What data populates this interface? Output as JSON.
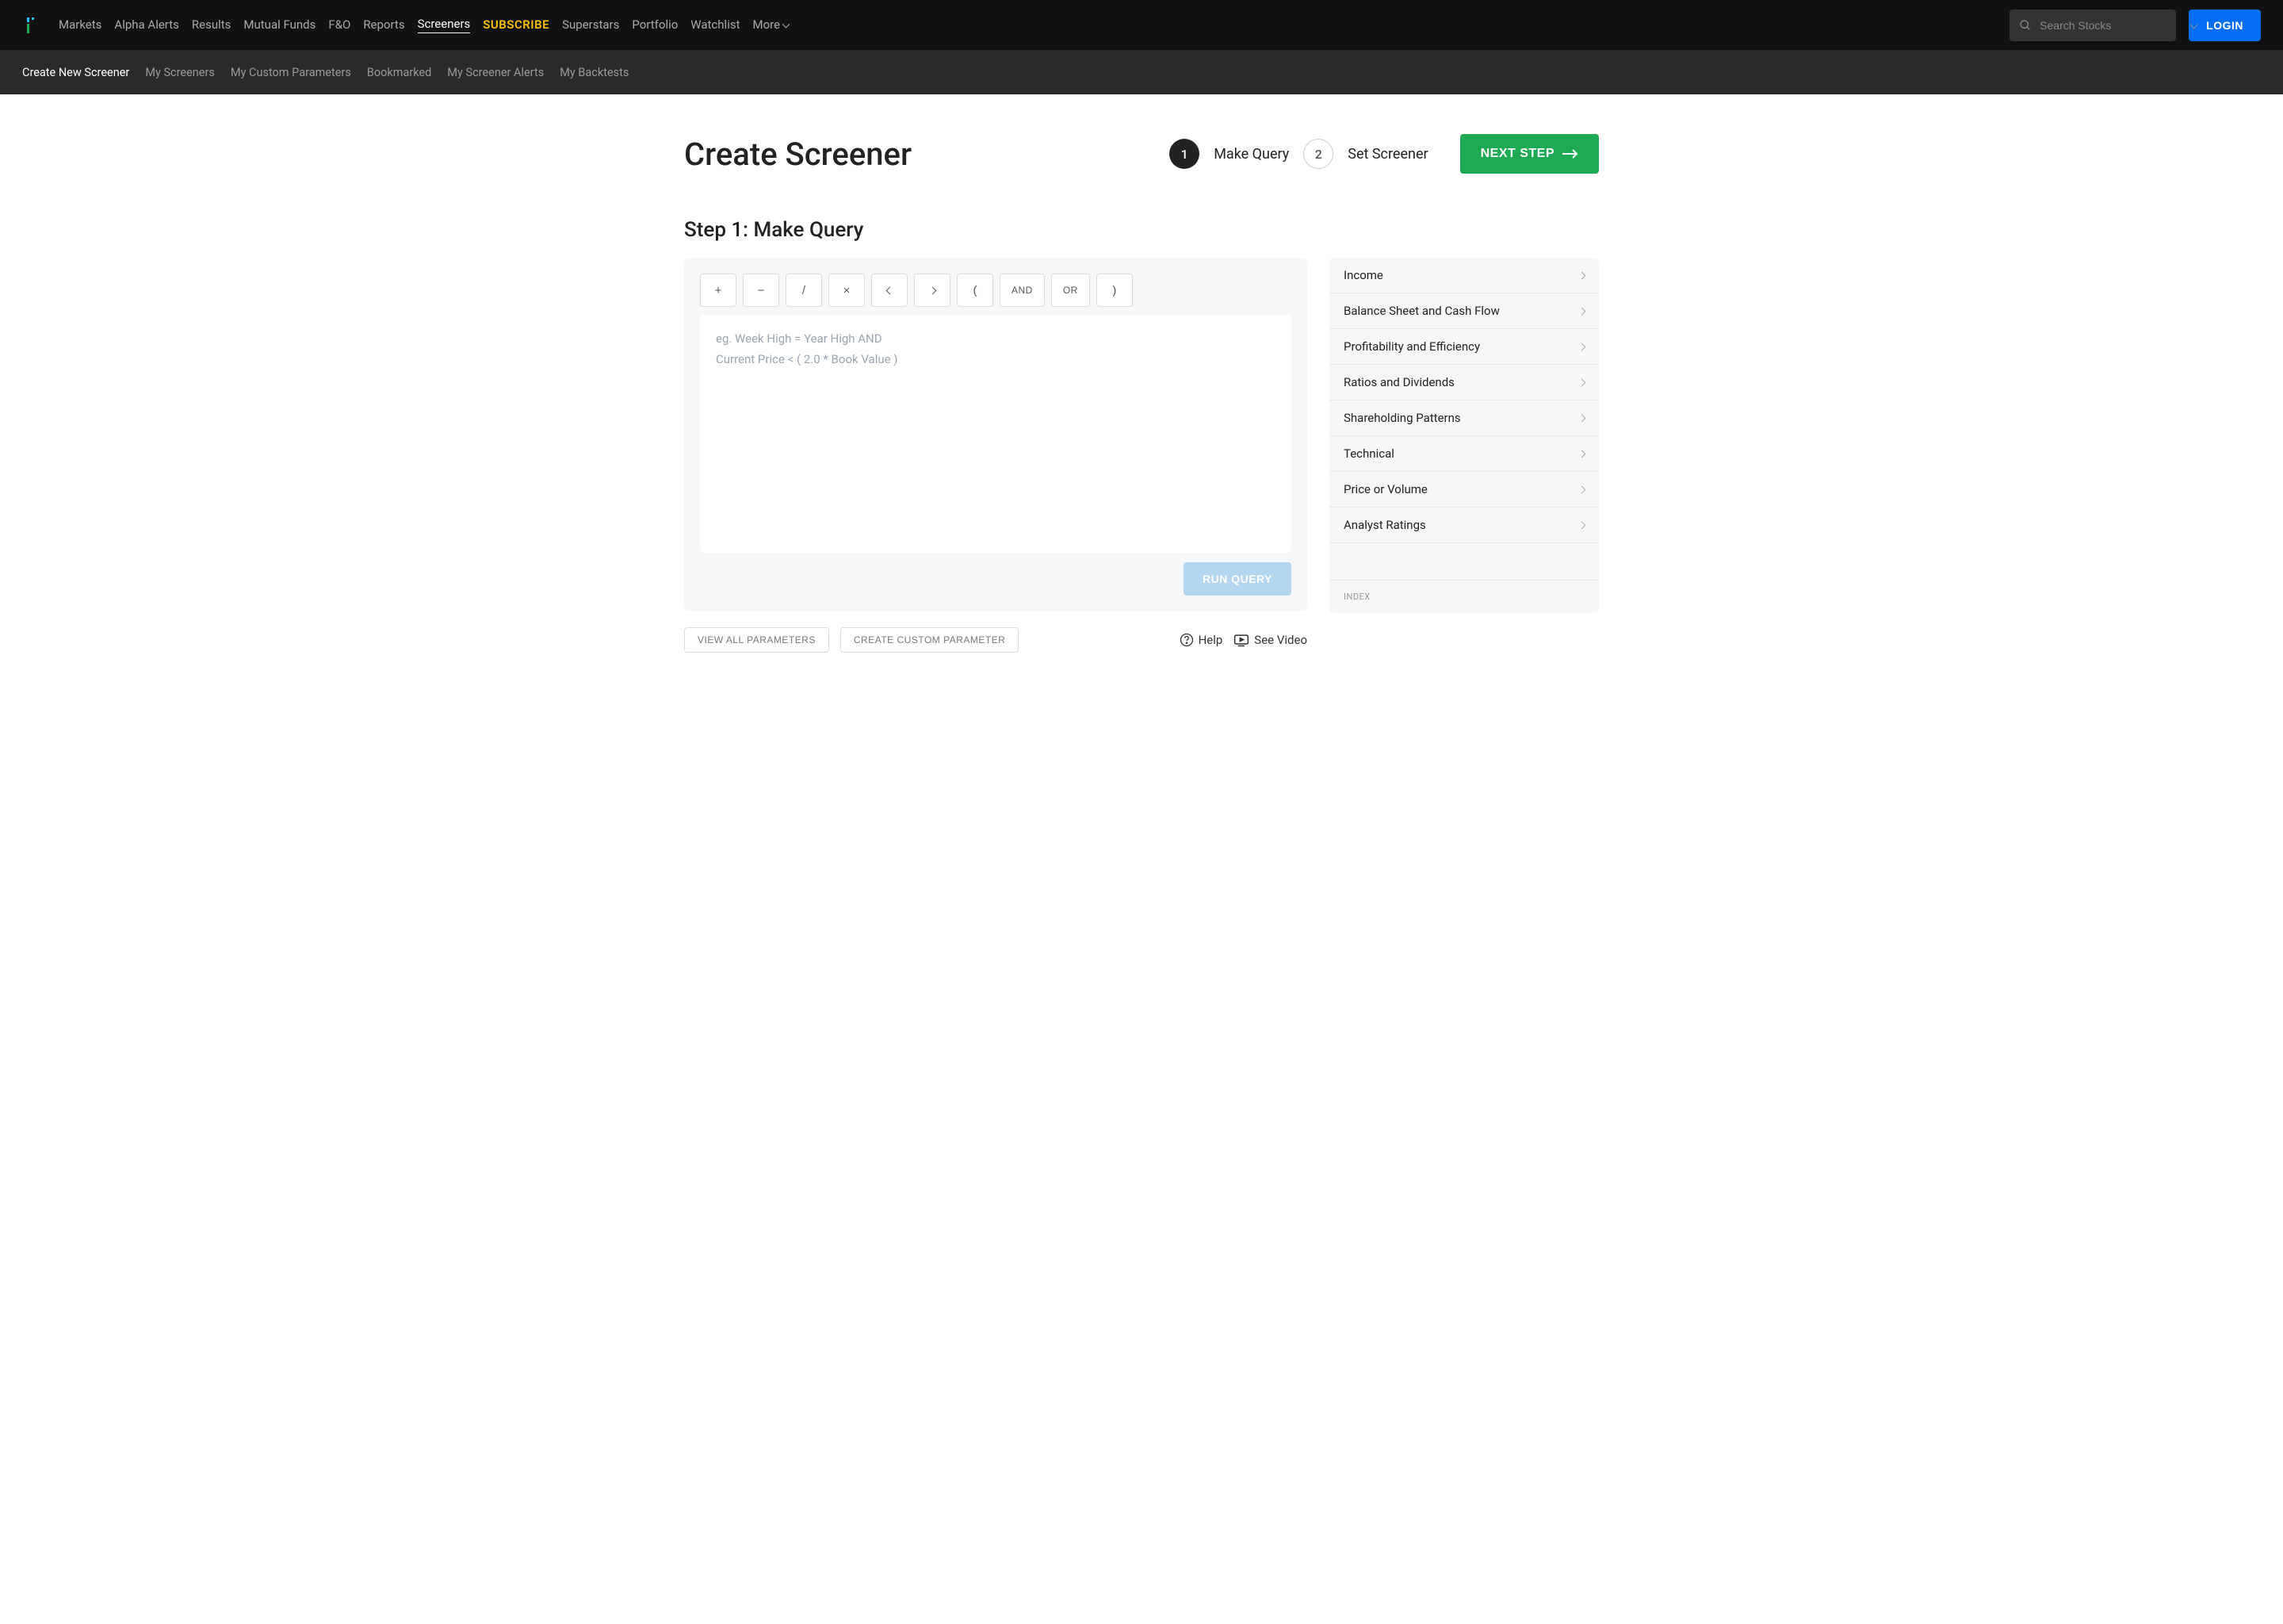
{
  "topnav": {
    "links": [
      "Markets",
      "Alpha Alerts",
      "Results",
      "Mutual Funds",
      "F&O",
      "Reports",
      "Screeners",
      "SUBSCRIBE",
      "Superstars",
      "Portfolio",
      "Watchlist",
      "More"
    ],
    "active_index": 6,
    "highlight_index": 7,
    "search_placeholder": "Search Stocks",
    "login_label": "LOGIN"
  },
  "subnav": {
    "items": [
      "Create New Screener",
      "My Screeners",
      "My Custom Parameters",
      "Bookmarked",
      "My Screener Alerts",
      "My Backtests"
    ],
    "active_index": 0
  },
  "page": {
    "title": "Create Screener",
    "section_title": "Step 1: Make Query"
  },
  "steps": {
    "items": [
      {
        "num": "1",
        "label": "Make Query",
        "active": true
      },
      {
        "num": "2",
        "label": "Set Screener",
        "active": false
      }
    ],
    "next_label": "NEXT STEP"
  },
  "query": {
    "operators": [
      "+",
      "−",
      "/",
      "×",
      "<",
      ">",
      "(",
      "AND",
      "OR",
      ")"
    ],
    "placeholder": "eg. Week High = Year High AND\nCurrent Price < ( 2.0 * Book Value )",
    "run_label": "RUN QUERY"
  },
  "bottom": {
    "view_params": "VIEW ALL PARAMETERS",
    "create_custom": "CREATE CUSTOM PARAMETER",
    "help": "Help",
    "see_video": "See Video"
  },
  "accordion": {
    "items": [
      "Income",
      "Balance Sheet and Cash Flow",
      "Profitability and Efficiency",
      "Ratios and Dividends",
      "Shareholding Patterns",
      "Technical",
      "Price or Volume",
      "Analyst Ratings"
    ],
    "footer": "INDEX"
  }
}
